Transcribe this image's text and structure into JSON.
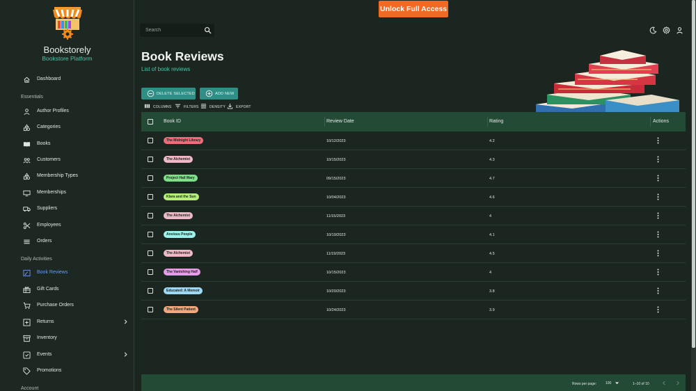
{
  "sidebar": {
    "brand": "Bookstorely",
    "brand_sub": "Bookstore Platform",
    "top_items": [
      {
        "label": "Dashboard",
        "icon": "home-icon"
      }
    ],
    "sections": [
      {
        "title": "Essentials"
      },
      {
        "title": "Daily Activities"
      },
      {
        "title": "Account"
      }
    ],
    "essentials": [
      {
        "label": "Author Profiles",
        "icon": "person-icon"
      },
      {
        "label": "Categories",
        "icon": "category-icon"
      },
      {
        "label": "Books",
        "icon": "book-icon"
      },
      {
        "label": "Customers",
        "icon": "people-icon"
      },
      {
        "label": "Membership Types",
        "icon": "category-icon"
      },
      {
        "label": "Memberships",
        "icon": "card-icon"
      },
      {
        "label": "Suppliers",
        "icon": "truck-icon"
      },
      {
        "label": "Employees",
        "icon": "scissors-icon"
      },
      {
        "label": "Orders",
        "icon": "list-icon"
      }
    ],
    "daily": [
      {
        "label": "Book Reviews",
        "icon": "review-icon",
        "active": true
      },
      {
        "label": "Gift Cards",
        "icon": "gift-icon"
      },
      {
        "label": "Purchase Orders",
        "icon": "cart-icon"
      },
      {
        "label": "Returns",
        "icon": "return-icon",
        "chevron": true
      },
      {
        "label": "Inventory",
        "icon": "archive-icon"
      },
      {
        "label": "Events",
        "icon": "calendar-icon",
        "chevron": true
      },
      {
        "label": "Promotions",
        "icon": "tag-icon"
      }
    ]
  },
  "topbar": {
    "unlock_label": "Unlock Full Access",
    "search_placeholder": "Search"
  },
  "header": {
    "title": "Book Reviews",
    "subtitle": "List of book reviews"
  },
  "actions": {
    "delete_label": "DELETE SELECTED",
    "add_label": "ADD NEW"
  },
  "toolbar": {
    "columns": "COLUMNS",
    "filters": "FILTERS",
    "density": "DENSITY",
    "export": "EXPORT"
  },
  "table": {
    "columns": [
      "Book ID",
      "Review Date",
      "Rating",
      "Actions"
    ],
    "rows": [
      {
        "book": "The Midnight Library",
        "date": "10/12/2023",
        "rating": "4.2",
        "chip_color": "#f26b7a"
      },
      {
        "book": "The Alchemist",
        "date": "10/15/2023",
        "rating": "4.3",
        "chip_color": "#f0b8c6"
      },
      {
        "book": "Project Hail Mary",
        "date": "09/15/2023",
        "rating": "4.7",
        "chip_color": "#7fe08a"
      },
      {
        "book": "Klara and the Sun",
        "date": "10/04/2023",
        "rating": "4.6",
        "chip_color": "#b6ee7a"
      },
      {
        "book": "The Alchemist",
        "date": "11/15/2023",
        "rating": "4",
        "chip_color": "#f0b8c6"
      },
      {
        "book": "Anxious People",
        "date": "10/19/2023",
        "rating": "4.1",
        "chip_color": "#9ef0ea"
      },
      {
        "book": "The Alchemist",
        "date": "11/19/2023",
        "rating": "4.5",
        "chip_color": "#f0b8c6"
      },
      {
        "book": "The Vanishing Half",
        "date": "10/15/2023",
        "rating": "4",
        "chip_color": "#e79be8"
      },
      {
        "book": "Educated: A Memoir",
        "date": "10/20/2023",
        "rating": "3.8",
        "chip_color": "#9fd8f5"
      },
      {
        "book": "The Silent Patient",
        "date": "10/24/2023",
        "rating": "3.9",
        "chip_color": "#f4a77a"
      }
    ]
  },
  "pagination": {
    "rows_per_page_label": "Rows per page:",
    "rows_per_page": "100",
    "range": "1–10 of 10"
  },
  "colors": {
    "accent": "#4fc3a6",
    "unlock": "#ee6a25",
    "table_header": "#224a35",
    "button": "#2f8f86",
    "active_nav": "#6b9cf0"
  }
}
